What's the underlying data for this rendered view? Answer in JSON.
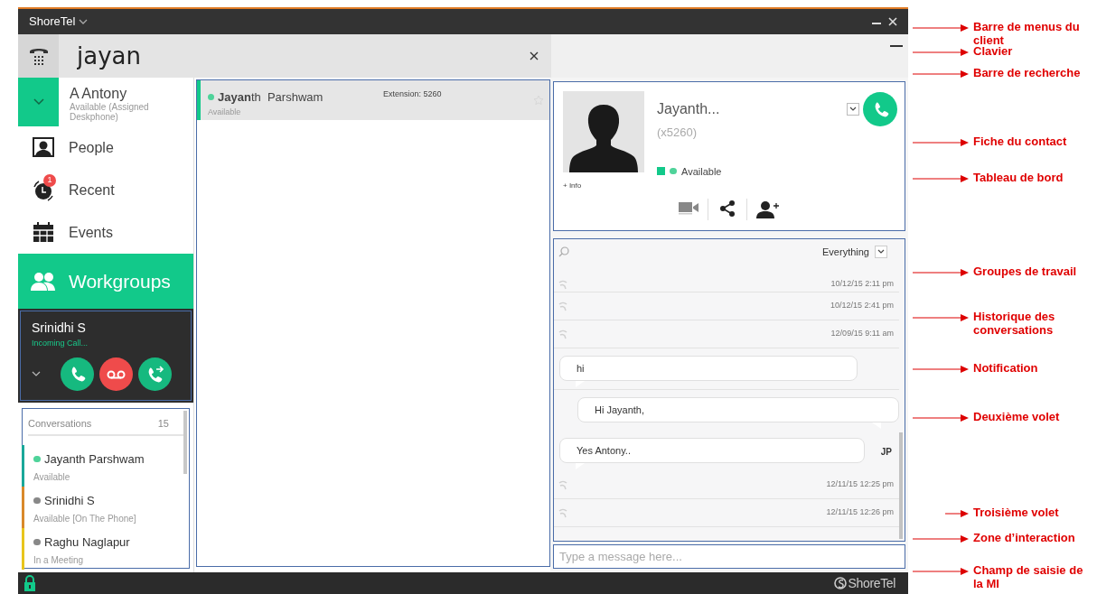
{
  "title_bar": {
    "app_name": "ShoreTel"
  },
  "search": {
    "value": "jayan"
  },
  "user": {
    "name": "A Antony",
    "status": "Available (Assigned Deskphone)"
  },
  "nav": [
    {
      "kind": "people",
      "label": "People",
      "selected": false
    },
    {
      "kind": "recent",
      "label": "Recent",
      "selected": false,
      "badge": "1"
    },
    {
      "kind": "events",
      "label": "Events",
      "selected": false
    },
    {
      "kind": "workgroups",
      "label": "Workgroups",
      "selected": true
    }
  ],
  "notification": {
    "caller": "Srinidhi S",
    "status": "Incoming Call..."
  },
  "conversations": {
    "title": "Conversations",
    "count": "15",
    "items": [
      {
        "name": "Jayanth Parshwam",
        "status": "Available",
        "available": true,
        "color": "#1aa89a"
      },
      {
        "name": "Srinidhi S",
        "status": "Available [On The Phone]",
        "available": false,
        "color": "#d9892b"
      },
      {
        "name": "Raghu Naglapur",
        "status": "In a Meeting",
        "available": false,
        "color": "#e8c51c"
      }
    ]
  },
  "results": [
    {
      "name": "**Jayan**th  Parshwam",
      "status": "Available",
      "extension": "Extension: 5260",
      "selected": true
    }
  ],
  "contact": {
    "name": "Jayanth...",
    "extension": "(x5260)",
    "status": "Available",
    "info_link": "+ Info"
  },
  "history": {
    "filter": "Everything",
    "items": [
      {
        "kind": "call",
        "time": "10/12/15 2:11 pm"
      },
      {
        "kind": "call",
        "time": "10/12/15 2:41 pm"
      },
      {
        "kind": "call",
        "time": "12/09/15 9:11 am"
      },
      {
        "kind": "received",
        "text": "hi"
      },
      {
        "kind": "sent",
        "text": "Hi Jayanth,"
      },
      {
        "kind": "received",
        "text": "Yes Antony..",
        "initials": "JP"
      },
      {
        "kind": "call",
        "time": "12/11/15 12:25 pm"
      },
      {
        "kind": "call",
        "time": "12/11/15 12:26 pm"
      }
    ]
  },
  "message_input": {
    "placeholder": "Type a message here..."
  },
  "footer": {
    "logo": "ShoreTel"
  },
  "annotations": [
    {
      "text": "Barre de menus du client"
    },
    {
      "text": "Clavier"
    },
    {
      "text": "Barre de recherche"
    },
    {
      "text": "Fiche du contact"
    },
    {
      "text": "Tableau de bord"
    },
    {
      "text": "Groupes de travail"
    },
    {
      "text": "Historique des conversations"
    },
    {
      "text": "Notification"
    },
    {
      "text": "Deuxième volet"
    },
    {
      "text": "Troisième volet"
    },
    {
      "text": "Zone d’interaction"
    },
    {
      "text": "Champ de saisie de la MI"
    }
  ]
}
